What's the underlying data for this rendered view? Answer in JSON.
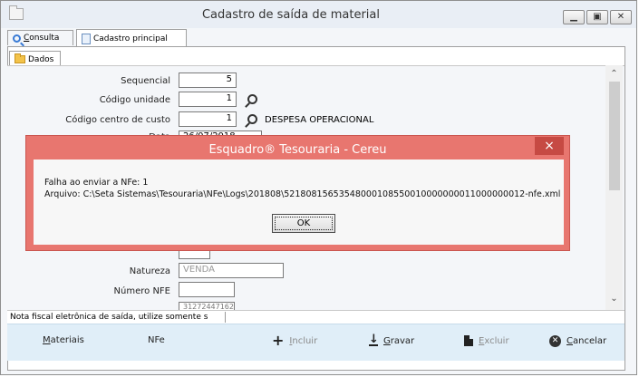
{
  "window": {
    "title": "Cadastro de saída de material"
  },
  "tabs": [
    {
      "label": "Consulta",
      "mnemonic": "C",
      "rest": "onsulta"
    },
    {
      "label": "Cadastro principal"
    }
  ],
  "subtab": {
    "label": "Dados"
  },
  "form": {
    "sequencial": {
      "label": "Sequencial",
      "value": "5"
    },
    "codigo_unidade": {
      "label": "Código unidade",
      "value": "1"
    },
    "codigo_centro_custo": {
      "label": "Código centro de custo",
      "value": "1",
      "description": "DESPESA OPERACIONAL"
    },
    "data": {
      "label": "Data",
      "value": "26/07/2018"
    },
    "natureza": {
      "label": "Natureza",
      "value": "VENDA"
    },
    "numero_nfe": {
      "label": "Número NFE",
      "value": ""
    },
    "extra_value": "31272447162"
  },
  "status_text": "Nota fiscal eletrônica de saída, utilize somente s",
  "toolbar": {
    "materiais": {
      "mnemonic": "M",
      "rest": "ateriais"
    },
    "nfe": "NFe",
    "incluir": {
      "mnemonic": "I",
      "rest": "ncluir"
    },
    "gravar": {
      "mnemonic": "G",
      "rest": "ravar"
    },
    "excluir": {
      "mnemonic": "E",
      "rest": "xcluir"
    },
    "cancelar": {
      "mnemonic": "C",
      "rest": "ancelar"
    }
  },
  "dialog": {
    "title": "Esquadro® Tesouraria - Cereu",
    "close": "×",
    "line1": "Falha ao enviar a NFe: 1",
    "line2": "Arquivo: C:\\Seta Sistemas\\Tesouraria\\NFe\\Logs\\201808\\52180815653548000108550010000000011000000012-nfe.xml",
    "ok": "OK"
  },
  "colors": {
    "dialog_frame": "#e8766f",
    "toolbar_bg": "#e0eef8",
    "titlebar_bg": "#e9eef5"
  },
  "icons": [
    "window-icon",
    "magnifier-icon",
    "document-icon",
    "folder-icon",
    "search-icon",
    "plus-icon",
    "save-icon",
    "delete-icon",
    "cancel-icon",
    "close-icon"
  ]
}
